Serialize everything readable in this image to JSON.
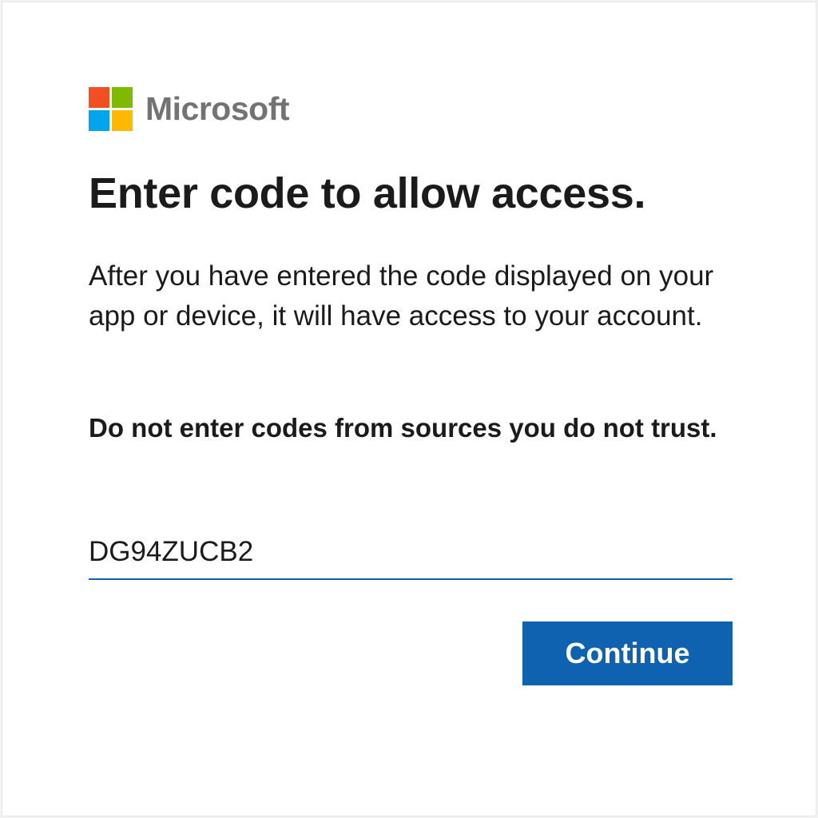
{
  "brand": {
    "name": "Microsoft",
    "logo_icon": "microsoft-logo-icon",
    "logo_colors": [
      "#F25022",
      "#7FBA00",
      "#00A4EF",
      "#FFB900"
    ]
  },
  "heading": {
    "title": "Enter code to allow access."
  },
  "content": {
    "description": "After you have entered the code displayed on your app or device, it will have access to your account.",
    "warning": "Do not enter codes from sources you do not trust."
  },
  "form": {
    "code_value": "DG94ZUCB2",
    "continue_label": "Continue"
  },
  "colors": {
    "accent": "#0F62B0",
    "text": "#1B1B1B",
    "wordmark": "#737373"
  }
}
